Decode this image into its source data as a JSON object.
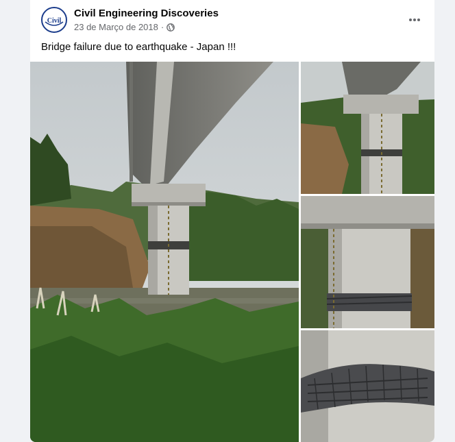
{
  "post": {
    "page_name": "Civil Engineering Discoveries",
    "avatar_text": "Civil",
    "date": "23 de Março de 2018",
    "separator": "·",
    "privacy_icon": "globe-icon",
    "more_icon": "more-horizontal-icon",
    "text": "Bridge failure due to earthquake - Japan !!!"
  },
  "photos": [
    {
      "name": "bridge-pier-wide"
    },
    {
      "name": "pier-top-right"
    },
    {
      "name": "pier-middle-right"
    },
    {
      "name": "pier-damage-closeup"
    }
  ],
  "colors": {
    "brand": "#1c3d8c",
    "sky": "#cfd5d8",
    "foliage": "#3f6b2a",
    "concrete": "#c9c8c2"
  }
}
